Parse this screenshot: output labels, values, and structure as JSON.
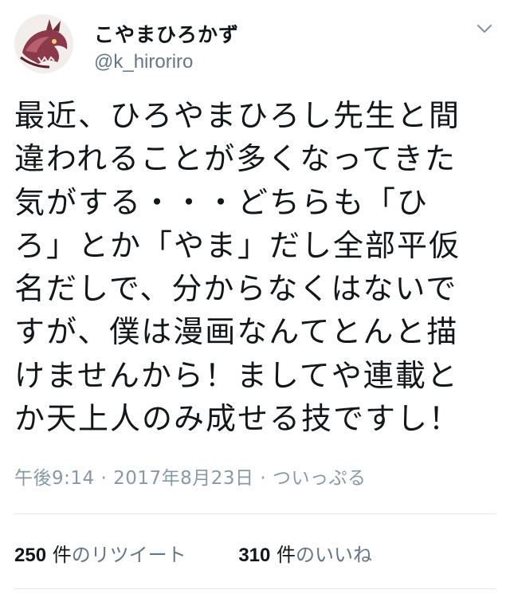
{
  "tweet": {
    "display_name": "こやまひろかず",
    "handle": "@k_hiroriro",
    "text_lines": [
      "最近、ひろやまひろし先生と間",
      "違われることが多くなってきた",
      "気がする・・・どちらも「ひ",
      "ろ」とか「やま」だし全部平仮",
      "名だしで、分からなくはないで",
      "すが、僕は漫画なんてとんと描",
      "けませんから！ましてや連載と",
      "か天上人のみ成せる技ですし！"
    ],
    "time": "午後9:14",
    "separator": "·",
    "date": "2017年8月23日",
    "via": "ついっぷる"
  },
  "stats": {
    "retweets": {
      "count": "250",
      "unit": "件",
      "label": "のリツイート"
    },
    "likes": {
      "count": "310",
      "unit": "件",
      "label": "のいいね"
    }
  },
  "icons": {
    "menu": "chevron-down-icon",
    "avatar": "avatar-dragon"
  },
  "colors": {
    "text": "#14171a",
    "secondary": "#657786",
    "meta": "#8899a6",
    "divider": "#e1e8ed"
  }
}
